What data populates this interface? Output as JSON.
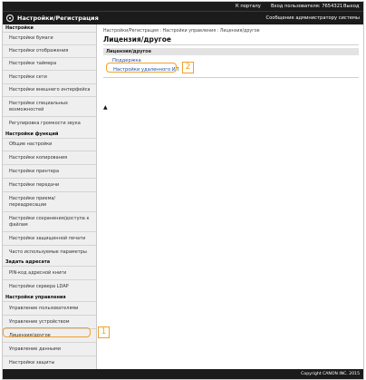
{
  "topbar": {
    "portal_link": "К порталу",
    "login_user": "Вход пользователя:  7654321",
    "logout": "Выход"
  },
  "header": {
    "title": "Настройки/Регистрация",
    "admin_message": "Сообщение администратору системы"
  },
  "sidebar": {
    "sections": [
      {
        "label": "Настройки",
        "items": [
          "Настройки бумаги",
          "Настройки отображения",
          "Настройки таймера",
          "Настройки сети",
          "Настройки внешнего интерфейса",
          "Настройки специальных возможностей",
          "Регулировка громкости звука"
        ]
      },
      {
        "label": "Настройки функций",
        "items": [
          "Общие настройки",
          "Настройки копирования",
          "Настройки принтера",
          "Настройки передачи",
          "Настройки приема/переадресации",
          "Настройки сохранения/доступа к файлам",
          "Настройки защищенной печати",
          "Часто используемые параметры"
        ]
      },
      {
        "label": "Задать адресата",
        "items": [
          "PIN-код адресной книги",
          "Настройки сервера LDAP"
        ]
      },
      {
        "label": "Настройки управления",
        "items": [
          "Управление пользователями",
          "Управление устройством",
          "Лицензия/другое",
          "Управление данными",
          "Настройки защиты"
        ]
      }
    ]
  },
  "main": {
    "breadcrumb": "Настройки/Регистрация : Настройки управления : Лицензия/другое",
    "page_title": "Лицензия/другое",
    "section_title": "Лицензия/другое",
    "links": [
      "Поддержка",
      "Настройки удаленного ИП"
    ]
  },
  "callouts": [
    "1",
    "2"
  ],
  "footer": {
    "copyright": "Copyright CANON INC. 2015"
  },
  "colors": {
    "accent": "#f0a12a",
    "header_bg": "#1b1b1b",
    "link": "#1f4fa8"
  }
}
